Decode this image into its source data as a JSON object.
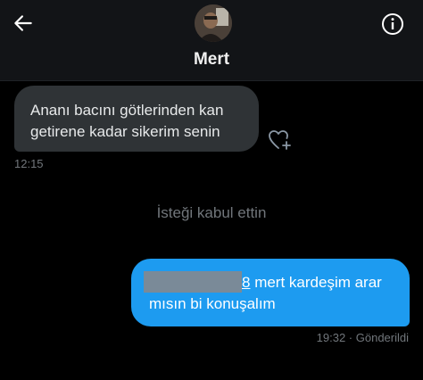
{
  "header": {
    "contact_name": "Mert",
    "back_icon": "arrow-left-icon",
    "info_icon": "info-circle-icon"
  },
  "messages": [
    {
      "direction": "incoming",
      "text": "Ananı bacını götlerinden kan getirene kadar sikerim senin",
      "time": "12:15"
    },
    {
      "direction": "system",
      "text": "İsteği kabul ettin"
    },
    {
      "direction": "outgoing",
      "link_tail": "8",
      "text": " mert kardeşim arar mısın bi konuşalım",
      "time_status": "19:32 · Gönderildi",
      "redacted": true
    }
  ],
  "colors": {
    "background": "#000000",
    "header": "#121417",
    "incoming_bubble": "#2f3336",
    "outgoing_bubble": "#1d9bf0",
    "muted_text": "#71767b"
  }
}
